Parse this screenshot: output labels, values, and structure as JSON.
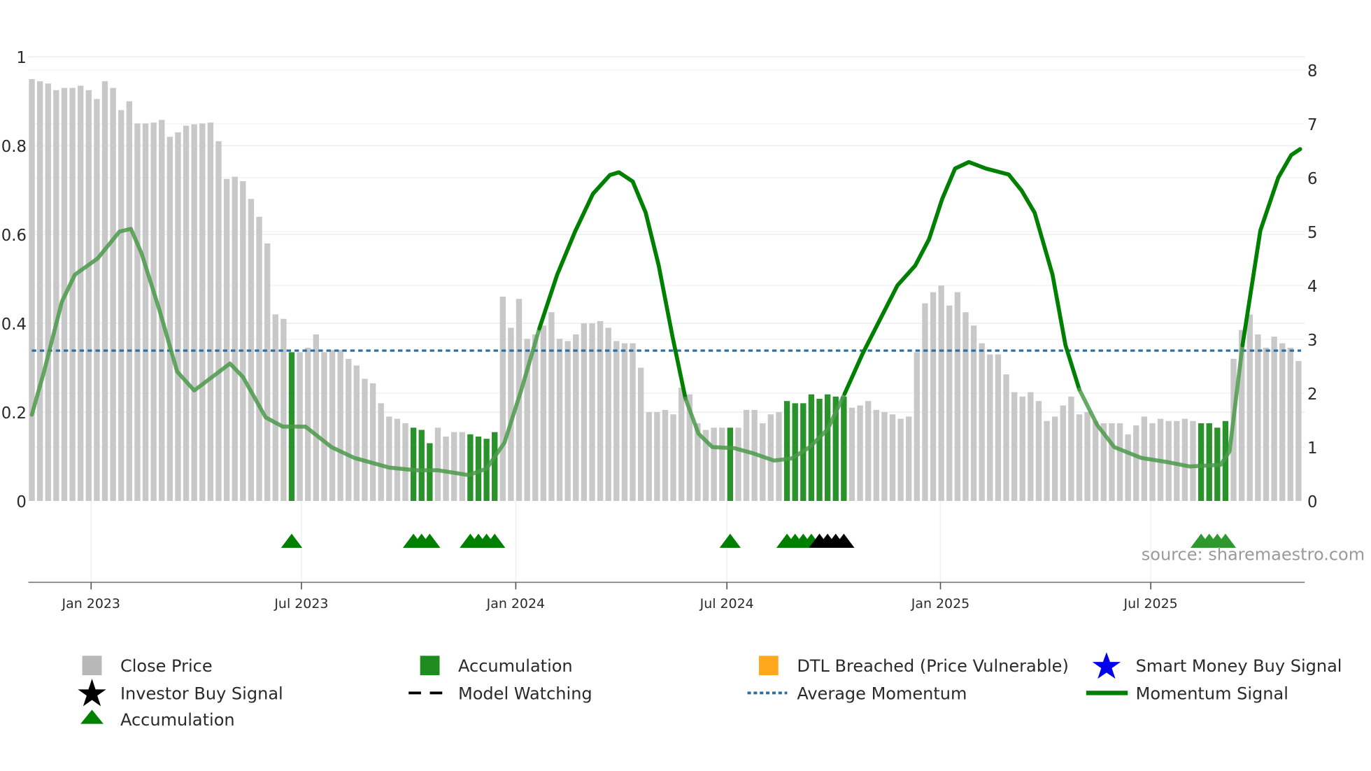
{
  "chart_data": {
    "type": "bar",
    "title": "",
    "x_unit": "week index (weekly bars)",
    "left_axis": {
      "label": "",
      "ylim": [
        0,
        1
      ],
      "ticks": [
        0,
        0.2,
        0.4,
        0.6,
        0.8,
        1
      ],
      "tick_labels": [
        "0",
        "0.2",
        "0.4",
        "0.6",
        "0.8",
        "1"
      ]
    },
    "right_axis": {
      "label": "",
      "ylim": [
        0,
        8
      ],
      "ticks": [
        0,
        1,
        2,
        3,
        4,
        5,
        6,
        7,
        8
      ],
      "tick_labels": [
        "0",
        "1",
        "2",
        "3",
        "4",
        "5",
        "6",
        "7",
        "8"
      ]
    },
    "x_ticks": [
      {
        "label": "Jan 2023",
        "week": 7.3
      },
      {
        "label": "Jul 2023",
        "week": 33.2
      },
      {
        "label": "Jan 2024",
        "week": 59.6
      },
      {
        "label": "Jul 2024",
        "week": 85.6
      },
      {
        "label": "Jan 2025",
        "week": 111.9
      },
      {
        "label": "Jul 2025",
        "week": 137.8
      }
    ],
    "close_price": [
      0.95,
      0.945,
      0.94,
      0.925,
      0.93,
      0.93,
      0.935,
      0.925,
      0.905,
      0.945,
      0.93,
      0.88,
      0.9,
      0.85,
      0.85,
      0.852,
      0.858,
      0.82,
      0.83,
      0.845,
      0.848,
      0.85,
      0.852,
      0.81,
      0.725,
      0.73,
      0.72,
      0.68,
      0.64,
      0.58,
      0.42,
      0.41,
      0.335,
      0.335,
      0.345,
      0.375,
      0.335,
      0.34,
      0.34,
      0.32,
      0.305,
      0.275,
      0.265,
      0.22,
      0.19,
      0.185,
      0.175,
      0.165,
      0.16,
      0.13,
      0.165,
      0.145,
      0.155,
      0.155,
      0.15,
      0.145,
      0.14,
      0.155,
      0.46,
      0.39,
      0.455,
      0.365,
      0.375,
      0.395,
      0.425,
      0.365,
      0.36,
      0.375,
      0.4,
      0.4,
      0.405,
      0.39,
      0.36,
      0.355,
      0.355,
      0.3,
      0.2,
      0.2,
      0.205,
      0.195,
      0.255,
      0.24,
      0.175,
      0.16,
      0.165,
      0.165,
      0.165,
      0.165,
      0.205,
      0.205,
      0.175,
      0.195,
      0.2,
      0.225,
      0.22,
      0.22,
      0.24,
      0.23,
      0.24,
      0.235,
      0.235,
      0.21,
      0.215,
      0.225,
      0.205,
      0.2,
      0.195,
      0.185,
      0.19,
      0.335,
      0.445,
      0.47,
      0.485,
      0.44,
      0.47,
      0.425,
      0.395,
      0.355,
      0.33,
      0.33,
      0.285,
      0.245,
      0.235,
      0.245,
      0.225,
      0.18,
      0.19,
      0.215,
      0.235,
      0.195,
      0.2,
      0.18,
      0.175,
      0.175,
      0.175,
      0.15,
      0.17,
      0.19,
      0.175,
      0.185,
      0.18,
      0.18,
      0.185,
      0.18,
      0.175,
      0.175,
      0.165,
      0.18,
      0.32,
      0.385,
      0.42,
      0.375,
      0.345,
      0.37,
      0.355,
      0.345,
      0.315
    ],
    "accumulation_bars": [
      32,
      47,
      48,
      49,
      54,
      55,
      56,
      57,
      86,
      93,
      94,
      95,
      96,
      97,
      98,
      99,
      100,
      144,
      145,
      146,
      147
    ],
    "momentum": [
      [
        0,
        1.6
      ],
      [
        1.5,
        2.4
      ],
      [
        3.7,
        3.7
      ],
      [
        5.3,
        4.2
      ],
      [
        8.1,
        4.5
      ],
      [
        10.8,
        5.0
      ],
      [
        12.2,
        5.05
      ],
      [
        13.5,
        4.6
      ],
      [
        15.7,
        3.55
      ],
      [
        17.9,
        2.4
      ],
      [
        20,
        2.05
      ],
      [
        22.2,
        2.3
      ],
      [
        24.4,
        2.55
      ],
      [
        26,
        2.3
      ],
      [
        28.8,
        1.55
      ],
      [
        30.9,
        1.38
      ],
      [
        33.7,
        1.38
      ],
      [
        36.9,
        1.0
      ],
      [
        39.7,
        0.8
      ],
      [
        44,
        0.62
      ],
      [
        47.3,
        0.57
      ],
      [
        50,
        0.57
      ],
      [
        53.8,
        0.48
      ],
      [
        56,
        0.6
      ],
      [
        58.2,
        1.08
      ],
      [
        60.3,
        2.07
      ],
      [
        62.5,
        3.2
      ],
      [
        64.7,
        4.2
      ],
      [
        66.9,
        5.0
      ],
      [
        69.1,
        5.7
      ],
      [
        71.2,
        6.05
      ],
      [
        72.3,
        6.1
      ],
      [
        74,
        5.93
      ],
      [
        75.6,
        5.35
      ],
      [
        77.2,
        4.37
      ],
      [
        78.9,
        3.05
      ],
      [
        80.5,
        1.9
      ],
      [
        82.1,
        1.25
      ],
      [
        83.8,
        1.0
      ],
      [
        86.5,
        0.98
      ],
      [
        88.7,
        0.89
      ],
      [
        91.4,
        0.75
      ],
      [
        93.6,
        0.79
      ],
      [
        95.8,
        1.0
      ],
      [
        98,
        1.33
      ],
      [
        100.1,
        1.99
      ],
      [
        102.3,
        2.73
      ],
      [
        104.5,
        3.38
      ],
      [
        106.6,
        4.0
      ],
      [
        108.8,
        4.37
      ],
      [
        110.5,
        4.86
      ],
      [
        112.1,
        5.6
      ],
      [
        113.7,
        6.17
      ],
      [
        115.4,
        6.29
      ],
      [
        117.5,
        6.17
      ],
      [
        120.3,
        6.06
      ],
      [
        121.9,
        5.76
      ],
      [
        123.5,
        5.35
      ],
      [
        125.7,
        4.2
      ],
      [
        127.3,
        2.89
      ],
      [
        129,
        2.07
      ],
      [
        131.2,
        1.41
      ],
      [
        133.3,
        1.0
      ],
      [
        136.6,
        0.8
      ],
      [
        139.9,
        0.72
      ],
      [
        142.6,
        0.64
      ],
      [
        146.4,
        0.67
      ],
      [
        147.5,
        0.92
      ],
      [
        149.1,
        2.89
      ],
      [
        151.3,
        5.02
      ],
      [
        153.5,
        6.0
      ],
      [
        155.1,
        6.42
      ],
      [
        156.2,
        6.53
      ]
    ],
    "momentum_faded_ranges": [
      [
        0,
        61.4
      ],
      [
        80.5,
        100.1
      ],
      [
        129,
        148
      ]
    ],
    "average_momentum": 2.79,
    "accumulation_markers": [
      32,
      47,
      48,
      49,
      54,
      55,
      56,
      57,
      86,
      93,
      94,
      95,
      96,
      144,
      145,
      146,
      147
    ],
    "black_markers": [
      97,
      98,
      99,
      100
    ],
    "grid": true,
    "legend_placement": "bottom",
    "colors": {
      "close": "#c8c8c8",
      "accumulation_bar": "#2a922a",
      "momentum": "#008000",
      "momentum_faded": "#4a9a4a",
      "average": "#2b6fa5",
      "dtl": "#ffa81e",
      "smart_money": "#0000ee",
      "marker_green": "#008000",
      "marker_black": "#000000"
    }
  },
  "legend": {
    "close_price": "Close Price",
    "accumulation_bar": "Accumulation",
    "dtl_breached": "DTL Breached (Price Vulnerable)",
    "smart_money": "Smart Money Buy Signal",
    "investor_buy": "Investor Buy Signal",
    "model_watching": "Model Watching",
    "average_momentum": "Average Momentum",
    "momentum_signal": "Momentum Signal",
    "accumulation_marker": "Accumulation"
  },
  "source": "source: sharemaestro.com"
}
